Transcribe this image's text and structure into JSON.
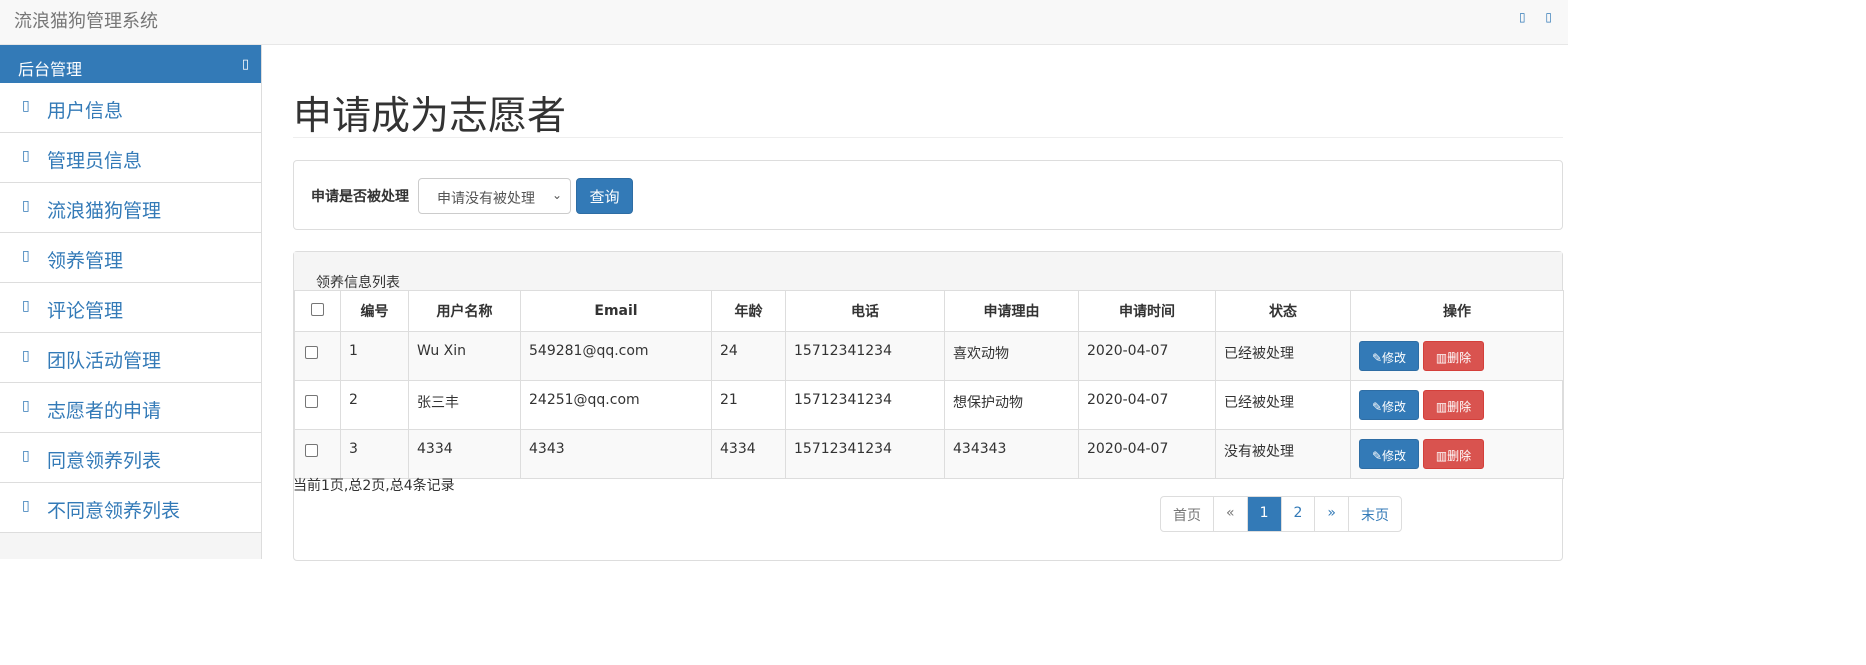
{
  "app": {
    "title": "流浪猫狗管理系统",
    "top_icons": "▯ ▯"
  },
  "sidebar": {
    "header": "后台管理",
    "items": [
      {
        "label": "用户信息"
      },
      {
        "label": "管理员信息"
      },
      {
        "label": "流浪猫狗管理"
      },
      {
        "label": "领养管理"
      },
      {
        "label": "评论管理"
      },
      {
        "label": "团队活动管理"
      },
      {
        "label": "志愿者的申请"
      },
      {
        "label": "同意领养列表"
      },
      {
        "label": "不同意领养列表"
      }
    ]
  },
  "page": {
    "title": "申请成为志愿者"
  },
  "filter": {
    "label": "申请是否被处理",
    "selected": "申请没有被处理",
    "query_label": "查询"
  },
  "panel": {
    "title": "领养信息列表"
  },
  "table": {
    "headers": [
      "编号",
      "用户名称",
      "Email",
      "年龄",
      "电话",
      "申请理由",
      "申请时间",
      "状态",
      "操作"
    ],
    "rows": [
      {
        "id": "1",
        "name": "Wu Xin",
        "email": "549281@qq.com",
        "age": "24",
        "phone": "15712341234",
        "reason": "喜欢动物",
        "date": "2020-04-07",
        "status": "已经被处理"
      },
      {
        "id": "2",
        "name": "张三丰",
        "email": "24251@qq.com",
        "age": "21",
        "phone": "15712341234",
        "reason": "想保护动物",
        "date": "2020-04-07",
        "status": "已经被处理"
      },
      {
        "id": "3",
        "name": "4334",
        "email": "4343",
        "age": "4334",
        "phone": "15712341234",
        "reason": "434343",
        "date": "2020-04-07",
        "status": "没有被处理"
      }
    ],
    "edit_label": "修改",
    "delete_label": "删除"
  },
  "footer": {
    "info": "当前1页,总2页,总4条记录"
  },
  "pagination": {
    "first": "首页",
    "prev": "«",
    "pages": [
      "1",
      "2"
    ],
    "next": "»",
    "last": "末页",
    "current": "1"
  },
  "colors": {
    "primary": "#337ab7",
    "danger": "#d9534f"
  }
}
